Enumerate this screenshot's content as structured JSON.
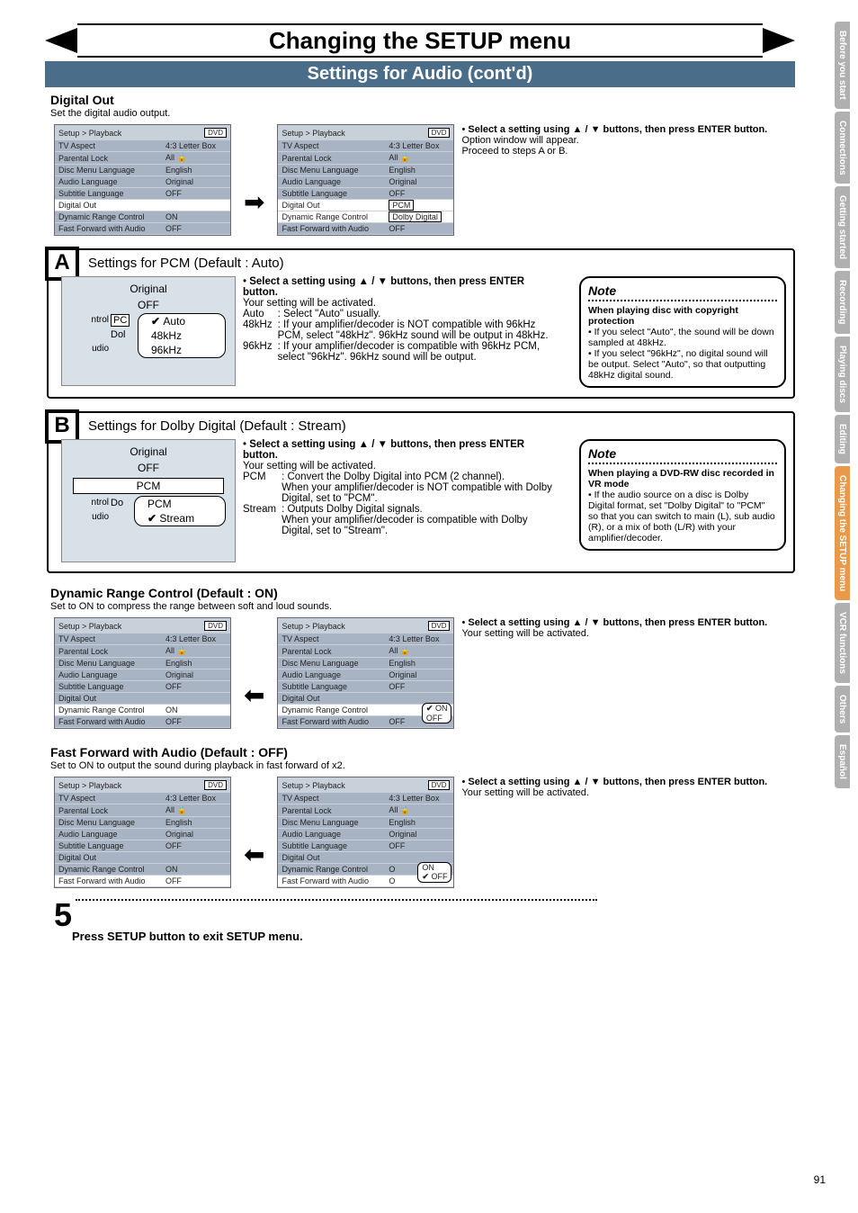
{
  "title": "Changing the SETUP menu",
  "subtitle": "Settings for Audio (cont'd)",
  "section1": {
    "heading": "Digital Out",
    "sub": "Set the digital audio output.",
    "instr_bold": "Select a setting using ▲ / ▼ buttons, then press ENTER button.",
    "instr_rest1": "Option window will appear.",
    "instr_rest2": "Proceed to steps A or B."
  },
  "osd": {
    "crumb": "Setup > Playback",
    "dvd": "DVD",
    "rows": [
      {
        "k": "TV Aspect",
        "v": "4:3 Letter Box"
      },
      {
        "k": "Parental Lock",
        "v": "All  🔒"
      },
      {
        "k": "Disc Menu Language",
        "v": "English"
      },
      {
        "k": "Audio Language",
        "v": "Original"
      },
      {
        "k": "Subtitle Language",
        "v": "OFF"
      },
      {
        "k": "Digital Out",
        "v": ""
      },
      {
        "k": "Dynamic Range Control",
        "v": "ON"
      },
      {
        "k": "Fast Forward with Audio",
        "v": "OFF"
      }
    ],
    "popup_pcm": {
      "label": "PCM",
      "opts": [
        "Auto",
        "48kHz",
        "96kHz"
      ],
      "sel": "Auto"
    },
    "popup_dolby": {
      "label": "Dolby Digital",
      "opts": [
        "PCM",
        "Stream"
      ],
      "sel": "Stream"
    },
    "popup_drc": {
      "opts": [
        "ON",
        "OFF"
      ],
      "sel": "ON"
    },
    "popup_ff": {
      "opts": [
        "ON",
        "OFF"
      ],
      "sel": "OFF"
    }
  },
  "A": {
    "tag": "A",
    "title": "Settings for PCM (Default : Auto)",
    "snap_top": "Original",
    "snap_off": "OFF",
    "snap_big": "PCM",
    "edge1": "ntrol",
    "edge2": "udio",
    "edgev1": "Dol",
    "opts": [
      "Auto",
      "48kHz",
      "96kHz"
    ],
    "sel": "Auto",
    "instr_bold": "Select a setting using ▲ / ▼ buttons, then press ENTER button.",
    "instr_sub": "Your setting will be activated.",
    "d1k": "Auto",
    "d1v": ": Select \"Auto\" usually.",
    "d2k": "48kHz",
    "d2v": ": If your amplifier/decoder is NOT compatible with 96kHz PCM, select \"48kHz\". 96kHz sound will be output in 48kHz.",
    "d3k": "96kHz",
    "d3v": ": If your amplifier/decoder is compatible with 96kHz PCM, select \"96kHz\". 96kHz sound will be output.",
    "note_title": "Note",
    "note_h": "When playing disc with copyright protection",
    "note_li1": "If you select \"Auto\", the sound will be down sampled at 48kHz.",
    "note_li2": "If you select \"96kHz\", no digital sound will be output. Select \"Auto\", so that outputting 48kHz digital sound."
  },
  "B": {
    "tag": "B",
    "title": "Settings for Dolby Digital (Default : Stream)",
    "snap_top": "Original",
    "snap_off": "OFF",
    "snap_big": "PCM",
    "snap_big2": "Dolby",
    "edge1": "ntrol",
    "edge2": "udio",
    "edgev1": "Do",
    "opts": [
      "PCM",
      "Stream"
    ],
    "sel": "Stream",
    "instr_bold": "Select a setting using ▲ / ▼ buttons, then press ENTER button.",
    "instr_sub": "Your setting will be activated.",
    "d1k": "PCM",
    "d1v": ": Convert the Dolby Digital into PCM (2 channel).\nWhen your amplifier/decoder is NOT compatible with Dolby Digital, set to \"PCM\".",
    "d2k": "Stream",
    "d2v": ": Outputs Dolby Digital signals.\nWhen your amplifier/decoder is compatible with Dolby Digital, set to \"Stream\".",
    "note_title": "Note",
    "note_h": "When playing a DVD-RW disc recorded in VR mode",
    "note_li1": "If the audio source on a disc is Dolby Digital format, set \"Dolby Digital\" to \"PCM\" so that you can switch to main (L), sub audio (R), or a mix of both (L/R) with your amplifier/decoder."
  },
  "DRC": {
    "heading": "Dynamic Range Control (Default : ON)",
    "sub": "Set to ON to compress the range between soft and loud sounds.",
    "instr_bold": "Select a setting using ▲ / ▼ buttons, then press ENTER button.",
    "instr_rest1": "Your setting will be activated."
  },
  "FF": {
    "heading": "Fast Forward with Audio (Default : OFF)",
    "sub": "Set to ON to output the sound during playback in fast forward of x2.",
    "instr_bold": "Select a setting using ▲ / ▼ buttons, then press ENTER button.",
    "instr_rest1": "Your setting will be activated."
  },
  "step5": {
    "num": "5",
    "text": "Press SETUP button to exit SETUP menu."
  },
  "tabs": [
    "Before you start",
    "Connections",
    "Getting started",
    "Recording",
    "Playing discs",
    "Editing",
    "Changing the SETUP menu",
    "VCR functions",
    "Others",
    "Español"
  ],
  "tab_current": "Changing the SETUP menu",
  "pageNum": "91"
}
